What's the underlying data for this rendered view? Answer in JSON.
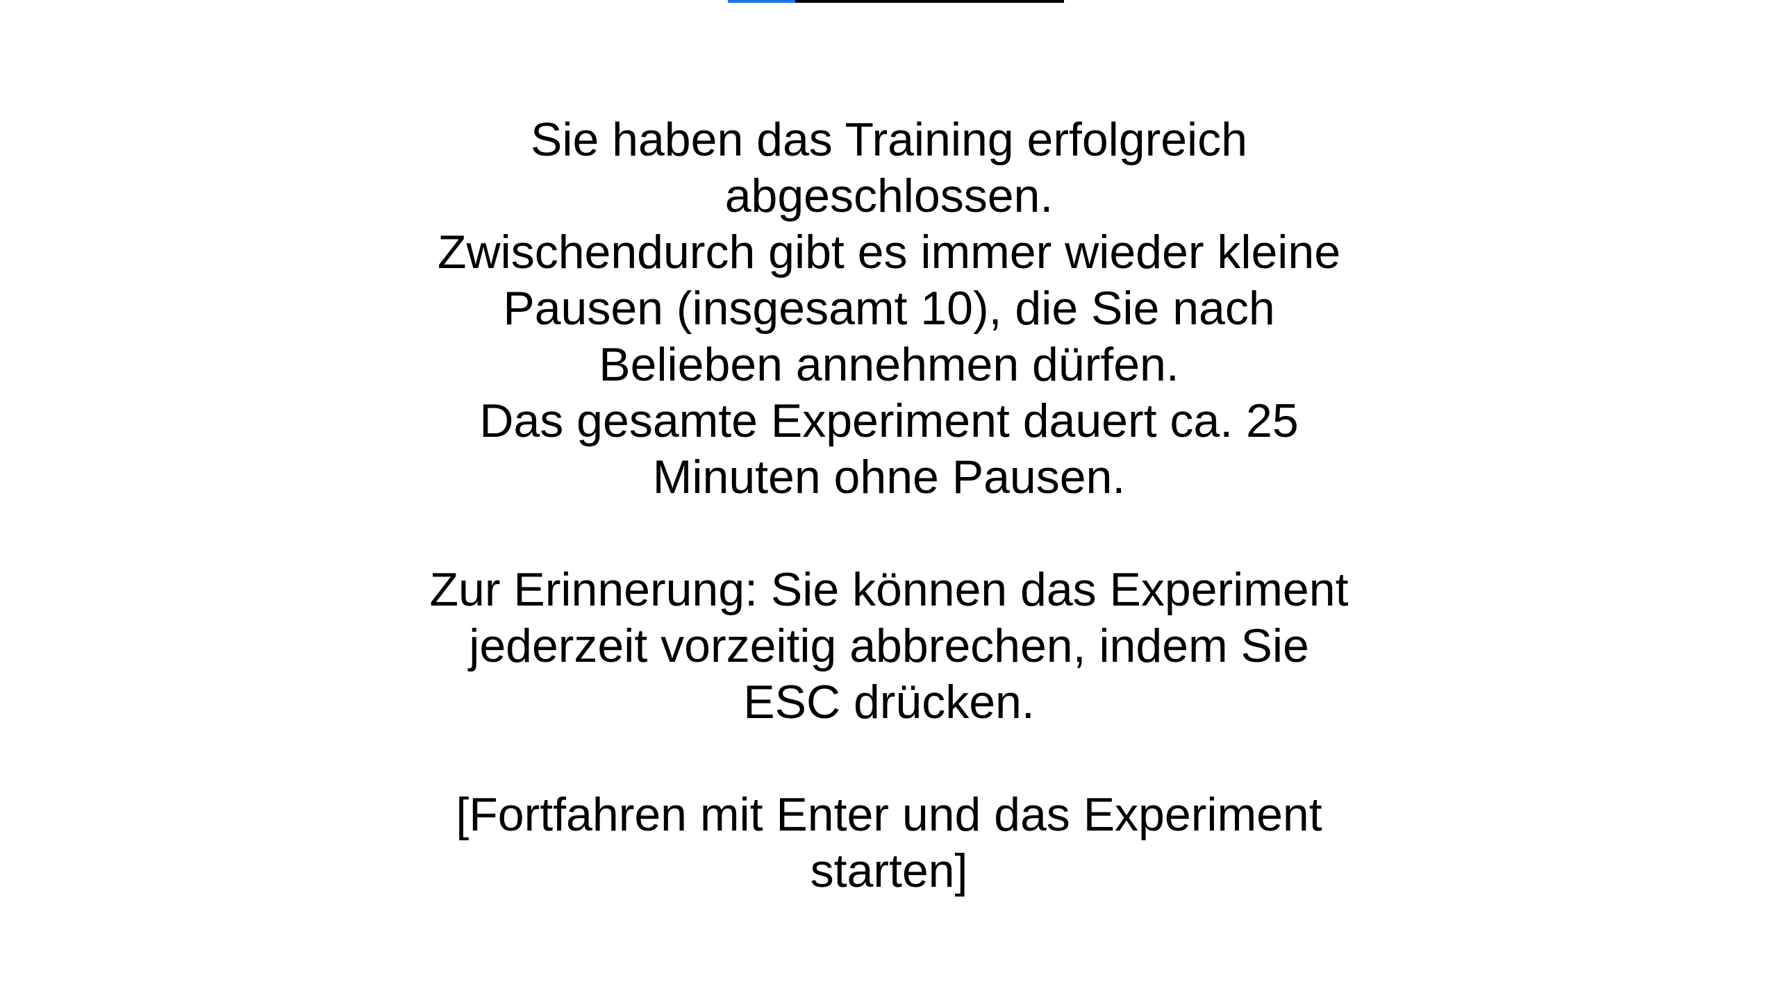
{
  "progress": {
    "fraction": 0.2,
    "fill_color": "#1a73e8",
    "track_color": "#000000"
  },
  "instructions": {
    "block1": [
      "Sie haben das Training erfolgreich",
      "abgeschlossen.",
      "Zwischendurch gibt es immer wieder kleine",
      "Pausen (insgesamt 10), die Sie nach",
      "Belieben annehmen dürfen.",
      "Das gesamte Experiment dauert ca. 25",
      "Minuten ohne Pausen."
    ],
    "block2": [
      "Zur Erinnerung: Sie können das Experiment",
      "jederzeit vorzeitig abbrechen, indem Sie",
      "ESC drücken."
    ],
    "block3": [
      "[Fortfahren mit Enter und das Experiment",
      "starten]"
    ]
  }
}
